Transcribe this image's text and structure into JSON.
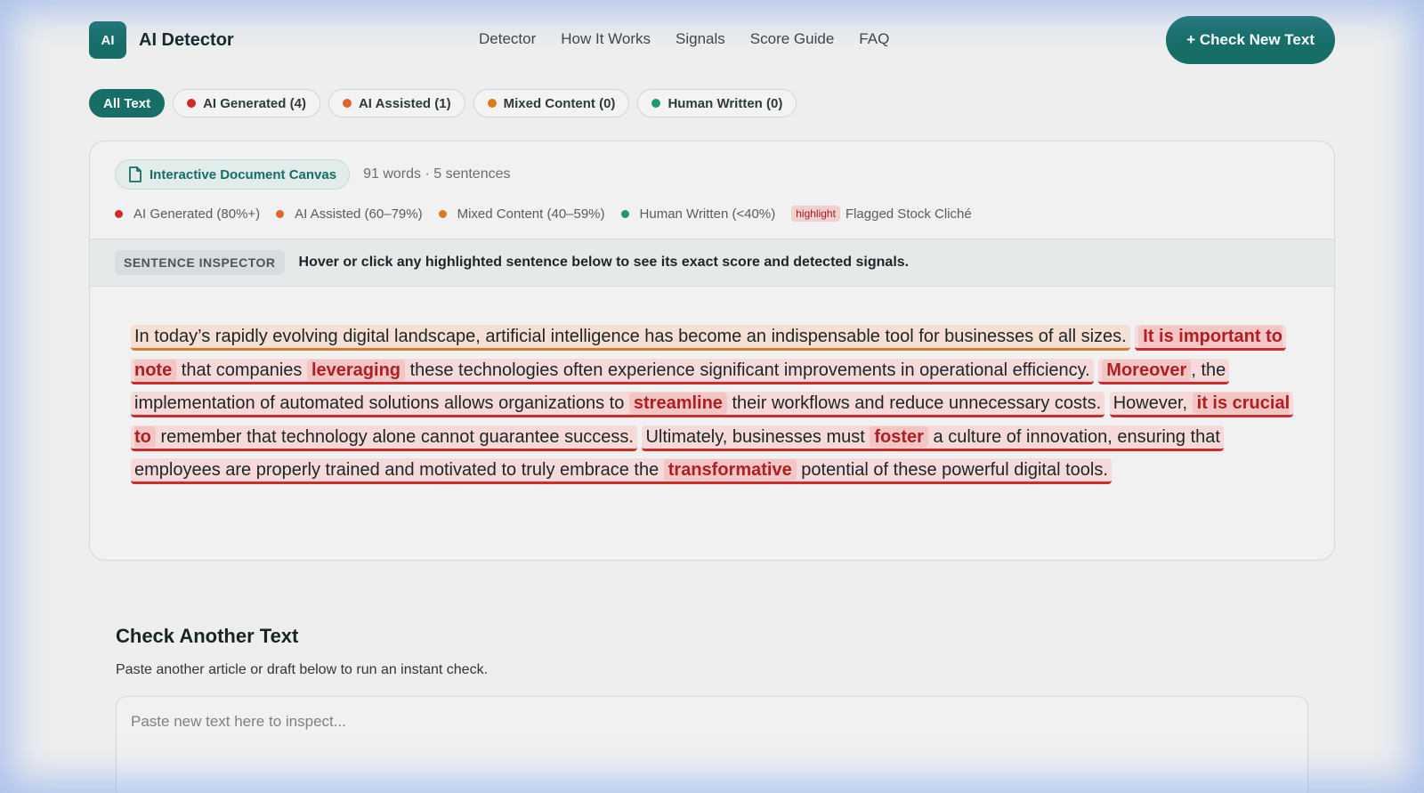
{
  "header": {
    "logo_mark": "AI",
    "app_name": "AI Detector",
    "nav": [
      "Detector",
      "How It Works",
      "Signals",
      "Score Guide",
      "FAQ"
    ],
    "cta": "+ Check New Text"
  },
  "filters": [
    {
      "label": "All Text",
      "active": true,
      "color": null
    },
    {
      "label": "AI Generated (4)",
      "active": false,
      "color": "#d02a2a"
    },
    {
      "label": "AI Assisted (1)",
      "active": false,
      "color": "#e0662a"
    },
    {
      "label": "Mixed Content (0)",
      "active": false,
      "color": "#dc7a1c"
    },
    {
      "label": "Human Written (0)",
      "active": false,
      "color": "#1e9a6a"
    }
  ],
  "canvas": {
    "badge": "Interactive Document Canvas",
    "meta": "91 words · 5 sentences",
    "legend": [
      {
        "label": "AI Generated (80%+)",
        "color": "#d02a2a"
      },
      {
        "label": "AI Assisted (60–79%)",
        "color": "#e0662a"
      },
      {
        "label": "Mixed Content (40–59%)",
        "color": "#dc7a1c"
      },
      {
        "label": "Human Written (<40%)",
        "color": "#1e9a6a"
      }
    ],
    "highlight_chip": "highlight",
    "highlight_label": "Flagged Stock Cliché",
    "inspector_tag": "SENTENCE INSPECTOR",
    "inspector_text": "Hover or click any highlighted sentence below to see its exact score and detected signals.",
    "sentences": [
      {
        "cls": "assist",
        "parts": [
          {
            "t": "In today’s rapidly evolving digital landscape, artificial intelligence has become an indispensable tool for businesses of all sizes."
          }
        ]
      },
      {
        "cls": "ai",
        "parts": [
          {
            "t": "It is important to note",
            "c": true
          },
          {
            "t": " that companies "
          },
          {
            "t": "leveraging",
            "c": true
          },
          {
            "t": " these technologies often experience significant improvements in operational efficiency."
          }
        ]
      },
      {
        "cls": "ai",
        "parts": [
          {
            "t": "Moreover",
            "c": true
          },
          {
            "t": ", the implementation of automated solutions allows organizations to "
          },
          {
            "t": "streamline",
            "c": true
          },
          {
            "t": " their workflows and reduce unnecessary costs."
          }
        ]
      },
      {
        "cls": "ai",
        "parts": [
          {
            "t": "However, "
          },
          {
            "t": "it is crucial to",
            "c": true
          },
          {
            "t": " remember that technology alone cannot guarantee success."
          }
        ]
      },
      {
        "cls": "ai",
        "parts": [
          {
            "t": "Ultimately, businesses must "
          },
          {
            "t": "foster",
            "c": true
          },
          {
            "t": " a culture of innovation, ensuring that employees are properly trained and motivated to truly embrace the "
          },
          {
            "t": "transformative",
            "c": true
          },
          {
            "t": " potential of these powerful digital tools."
          }
        ]
      }
    ]
  },
  "check": {
    "title": "Check Another Text",
    "subtitle": "Paste another article or draft below to run an instant check.",
    "placeholder": "Paste new text here to inspect..."
  }
}
